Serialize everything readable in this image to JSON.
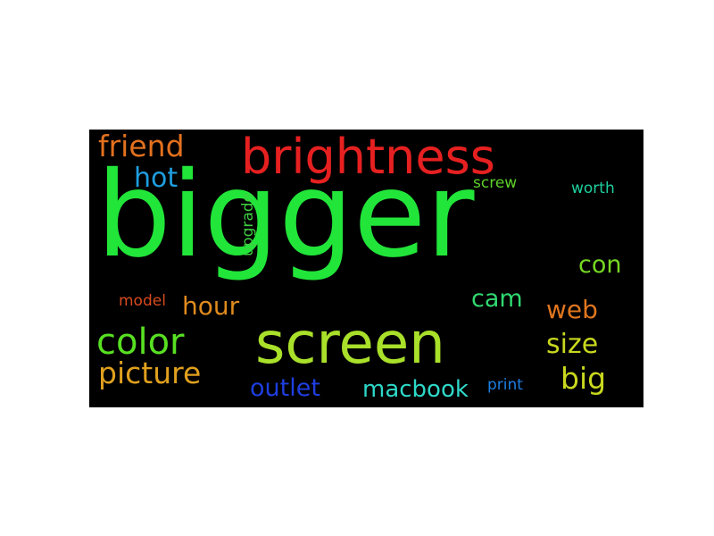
{
  "word_cloud": {
    "background": "#000000",
    "words": [
      {
        "text": "bigger",
        "color": "#22e53a",
        "rotated": false
      },
      {
        "text": "screen",
        "color": "#a9e02a",
        "rotated": false
      },
      {
        "text": "brightness",
        "color": "#e62020",
        "rotated": false
      },
      {
        "text": "color",
        "color": "#58e022",
        "rotated": false
      },
      {
        "text": "friend",
        "color": "#e2701e",
        "rotated": false
      },
      {
        "text": "hot",
        "color": "#1e9ee0",
        "rotated": false
      },
      {
        "text": "upgrade",
        "color": "#3fcf41",
        "rotated": true
      },
      {
        "text": "screw",
        "color": "#5ccf2a",
        "rotated": false
      },
      {
        "text": "worth",
        "color": "#1ecf9e",
        "rotated": false
      },
      {
        "text": "con",
        "color": "#76d822",
        "rotated": false
      },
      {
        "text": "cam",
        "color": "#30d870",
        "rotated": false
      },
      {
        "text": "model",
        "color": "#d84a1e",
        "rotated": false
      },
      {
        "text": "hour",
        "color": "#e08a1e",
        "rotated": false
      },
      {
        "text": "web",
        "color": "#e0761e",
        "rotated": false
      },
      {
        "text": "size",
        "color": "#c8d81e",
        "rotated": false
      },
      {
        "text": "picture",
        "color": "#e0a01e",
        "rotated": false
      },
      {
        "text": "big",
        "color": "#c8d81e",
        "rotated": false
      },
      {
        "text": "outlet",
        "color": "#1e3ee0",
        "rotated": false
      },
      {
        "text": "macbook",
        "color": "#2ed8c8",
        "rotated": false
      },
      {
        "text": "print",
        "color": "#1e7ee0",
        "rotated": false
      }
    ]
  }
}
